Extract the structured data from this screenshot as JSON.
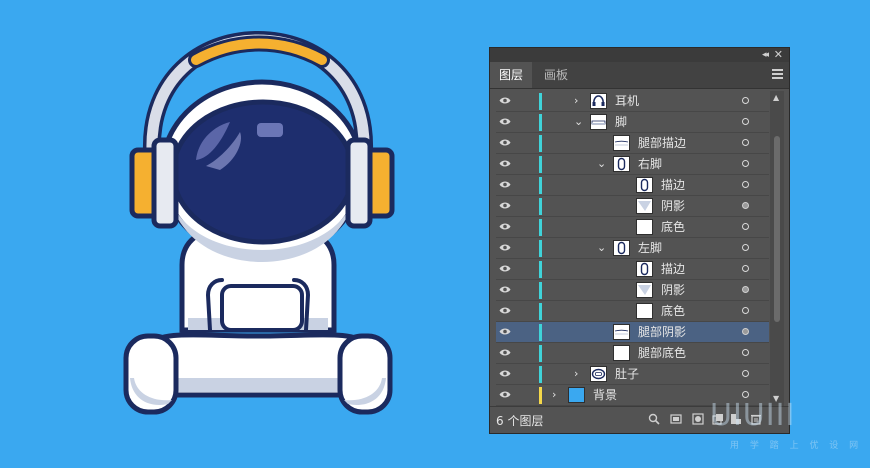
{
  "panel": {
    "tabs": [
      "图层",
      "画板"
    ],
    "layer_count": "6 个图层",
    "rows": [
      {
        "label": "耳机",
        "indent": 0,
        "chevron": "›",
        "thumb": "headphones",
        "bar": "cyan",
        "target": "empty",
        "selected": false
      },
      {
        "label": "脚",
        "indent": 0,
        "chevron": "⌄",
        "thumb": "legs",
        "bar": "cyan",
        "target": "empty",
        "selected": false
      },
      {
        "label": "腿部描边",
        "indent": 1,
        "chevron": "",
        "thumb": "leg-stroke",
        "bar": "cyan",
        "target": "empty",
        "selected": false
      },
      {
        "label": "右脚",
        "indent": 1,
        "chevron": "⌄",
        "thumb": "foot",
        "bar": "cyan",
        "target": "empty",
        "selected": false
      },
      {
        "label": "描边",
        "indent": 2,
        "chevron": "",
        "thumb": "foot",
        "bar": "cyan",
        "target": "empty",
        "selected": false
      },
      {
        "label": "阴影",
        "indent": 2,
        "chevron": "",
        "thumb": "shadow",
        "bar": "cyan",
        "target": "filled",
        "selected": false
      },
      {
        "label": "底色",
        "indent": 2,
        "chevron": "",
        "thumb": "blank",
        "bar": "cyan",
        "target": "empty",
        "selected": false
      },
      {
        "label": "左脚",
        "indent": 1,
        "chevron": "⌄",
        "thumb": "foot",
        "bar": "cyan",
        "target": "empty",
        "selected": false
      },
      {
        "label": "描边",
        "indent": 2,
        "chevron": "",
        "thumb": "foot",
        "bar": "cyan",
        "target": "empty",
        "selected": false
      },
      {
        "label": "阴影",
        "indent": 2,
        "chevron": "",
        "thumb": "shadow",
        "bar": "cyan",
        "target": "filled",
        "selected": false
      },
      {
        "label": "底色",
        "indent": 2,
        "chevron": "",
        "thumb": "blank",
        "bar": "cyan",
        "target": "empty",
        "selected": false
      },
      {
        "label": "腿部阴影",
        "indent": 1,
        "chevron": "",
        "thumb": "leg-stroke",
        "bar": "cyan",
        "target": "filled",
        "selected": true
      },
      {
        "label": "腿部底色",
        "indent": 1,
        "chevron": "",
        "thumb": "blank",
        "bar": "cyan",
        "target": "empty",
        "selected": false
      },
      {
        "label": "肚子",
        "indent": 0,
        "chevron": "›",
        "thumb": "belly",
        "bar": "cyan",
        "target": "empty",
        "selected": false
      },
      {
        "label": "背景",
        "indent": -1,
        "chevron": "›",
        "thumb": "background",
        "bar": "yellow",
        "target": "empty",
        "selected": false
      }
    ]
  },
  "watermark": {
    "brand": "UIUIII",
    "slogan": "用 学 踏 上 优 设 网"
  },
  "colors": {
    "background": "#3aa8f0",
    "panel": "#535353",
    "selected_row": "#4b6283",
    "layer_cyan": "#3fd3d9",
    "layer_yellow": "#f5d84a",
    "helmet_visor": "#1e2e6e",
    "outline": "#1b2a5e",
    "headphone_orange": "#f5b030"
  }
}
